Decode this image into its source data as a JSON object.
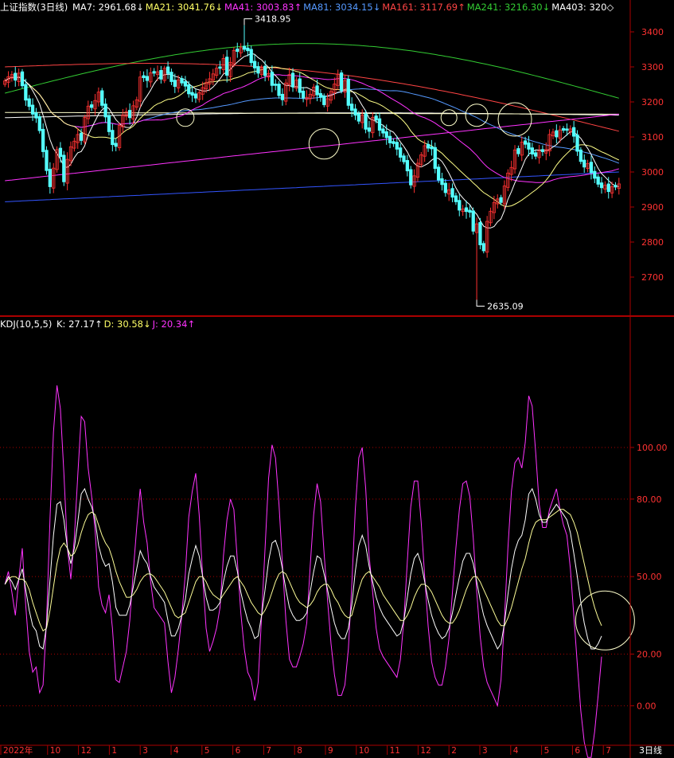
{
  "header": {
    "title": "上证指数(3日线)",
    "ma": [
      {
        "label": "MA7:",
        "value": "2961.68",
        "arrow": "↓",
        "color": "#ffffff"
      },
      {
        "label": "MA21:",
        "value": "3041.76",
        "arrow": "↓",
        "color": "#ffff66"
      },
      {
        "label": "MA41:",
        "value": "3003.83",
        "arrow": "↑",
        "color": "#ff33ff"
      },
      {
        "label": "MA81:",
        "value": "3034.15",
        "arrow": "↓",
        "color": "#5599ff"
      },
      {
        "label": "MA161:",
        "value": "3117.69",
        "arrow": "↑",
        "color": "#ff4444"
      },
      {
        "label": "MA241:",
        "value": "3216.30",
        "arrow": "↓",
        "color": "#33cc33"
      },
      {
        "label": "MA403:",
        "value": "320",
        "arrow": "◇",
        "color": "#ffffff"
      }
    ]
  },
  "kdj_header": {
    "title": "KDJ(10,5,5)",
    "items": [
      {
        "label": "K:",
        "value": "27.17",
        "arrow": "↑",
        "color": "#ffffff"
      },
      {
        "label": "D:",
        "value": "30.58",
        "arrow": "↓",
        "color": "#ffff66"
      },
      {
        "label": "J:",
        "value": "20.34",
        "arrow": "↑",
        "color": "#ff33ff"
      }
    ]
  },
  "colors": {
    "up": "#ff3232",
    "down": "#54ffff",
    "axis": "#aa0000",
    "tick": "#ff3232",
    "ma7": "#ffffff",
    "ma21": "#ffff88",
    "ma41": "#ff33ff",
    "ma81": "#5599ff",
    "ma161": "#ff4444",
    "ma241": "#33cc33",
    "ma403": "#ffffff"
  },
  "chart_data": [
    {
      "type": "candlestick",
      "title": "上证指数(3日线)",
      "ylim": [
        2600,
        3450
      ],
      "y_ticks": [
        "3400",
        "3300",
        "3200",
        "3100",
        "3000",
        "2900",
        "2800",
        "2700"
      ],
      "annotations": [
        {
          "label": "3418.95",
          "kind": "high",
          "value": 3418.95,
          "index": 69
        },
        {
          "label": "2635.09",
          "kind": "low",
          "value": 2635.09,
          "index": 136
        }
      ],
      "closes": [
        3260,
        3272,
        3278,
        3262,
        3282,
        3246,
        3205,
        3187,
        3165,
        3154,
        3118,
        3058,
        3004,
        2958,
        3011,
        3064,
        3044,
        2972,
        3036,
        3072,
        3088,
        3107,
        3090,
        3156,
        3188,
        3184,
        3204,
        3228,
        3190,
        3157,
        3115,
        3078,
        3073,
        3133,
        3163,
        3172,
        3155,
        3189,
        3206,
        3271,
        3269,
        3261,
        3283,
        3282,
        3286,
        3265,
        3296,
        3281,
        3258,
        3244,
        3263,
        3254,
        3245,
        3223,
        3219,
        3211,
        3226,
        3241,
        3255,
        3266,
        3280,
        3296,
        3296,
        3324,
        3276,
        3313,
        3347,
        3344,
        3355,
        3350,
        3346,
        3312,
        3297,
        3282,
        3298,
        3275,
        3281,
        3247,
        3247,
        3218,
        3206,
        3254,
        3278,
        3243,
        3262,
        3227,
        3211,
        3213,
        3222,
        3242,
        3220,
        3213,
        3192,
        3209,
        3230,
        3251,
        3279,
        3232,
        3261,
        3190,
        3176,
        3162,
        3145,
        3162,
        3122,
        3116,
        3156,
        3148,
        3119,
        3111,
        3098,
        3083,
        3081,
        3065,
        3042,
        3029,
        3003,
        2963,
        2989,
        3025,
        3049,
        3075,
        3068,
        3066,
        3010,
        2977,
        2964,
        2941,
        2949,
        2928,
        2915,
        2891,
        2894,
        2887,
        2885,
        2831,
        2852,
        2792,
        2775,
        2859,
        2888,
        2913,
        2923,
        2913,
        2960,
        2997,
        3013,
        3063,
        3052,
        3085,
        3079,
        3065,
        3051,
        3045,
        3060,
        3058,
        3064,
        3107,
        3114,
        3100,
        3120,
        3119,
        3119,
        3123,
        3102,
        3059,
        3030,
        3014,
        3024,
        2998,
        2982,
        2965,
        2955,
        2962,
        2944,
        2958,
        2957,
        2966
      ]
    },
    {
      "type": "line",
      "title": "KDJ(10,5,5)",
      "ylim": [
        -15,
        145
      ],
      "y_ticks": [
        "100.00",
        "80.00",
        "50.00",
        "20.00",
        "0.00"
      ],
      "x_labels": [
        "2022年",
        "10",
        "12",
        "1",
        "3",
        "4",
        "5",
        "6",
        "7",
        "8",
        "9",
        "10",
        "11",
        "12",
        "2",
        "3",
        "4",
        "5",
        "6",
        "7"
      ],
      "x_label_period": "3日线",
      "series": [
        {
          "name": "K",
          "values": [
            47,
            50,
            48,
            45,
            49,
            53,
            45,
            37,
            31,
            29,
            23,
            22,
            31,
            49,
            66,
            78,
            79,
            72,
            61,
            55,
            61,
            71,
            82,
            84,
            80,
            77,
            72,
            62,
            57,
            54,
            55,
            48,
            38,
            35,
            35,
            35,
            39,
            46,
            53,
            60,
            57,
            55,
            50,
            46,
            44,
            42,
            40,
            33,
            27,
            27,
            30,
            35,
            41,
            51,
            57,
            62,
            58,
            50,
            42,
            37,
            37,
            38,
            40,
            48,
            54,
            58,
            58,
            52,
            44,
            38,
            33,
            30,
            26,
            27,
            35,
            45,
            56,
            63,
            64,
            60,
            53,
            45,
            38,
            35,
            33,
            33,
            34,
            36,
            44,
            52,
            58,
            57,
            51,
            45,
            38,
            32,
            28,
            26,
            26,
            30,
            39,
            52,
            62,
            66,
            62,
            54,
            48,
            42,
            38,
            35,
            33,
            31,
            29,
            27,
            28,
            33,
            42,
            51,
            57,
            59,
            55,
            48,
            41,
            35,
            31,
            28,
            26,
            27,
            30,
            36,
            43,
            50,
            56,
            59,
            59,
            55,
            48,
            41,
            35,
            31,
            28,
            25,
            22,
            24,
            32,
            43,
            53,
            60,
            64,
            66,
            72,
            82,
            84,
            80,
            74,
            71,
            71,
            74,
            76,
            78,
            76,
            74,
            72,
            67,
            59,
            50,
            40,
            32,
            26,
            22,
            22,
            24,
            27
          ]
        },
        {
          "name": "D",
          "values": [
            47,
            49,
            50,
            50,
            49,
            49,
            48,
            45,
            40,
            36,
            32,
            29,
            30,
            37,
            46,
            55,
            61,
            63,
            61,
            58,
            59,
            62,
            67,
            71,
            74,
            75,
            74,
            70,
            66,
            63,
            61,
            57,
            52,
            48,
            45,
            42,
            42,
            43,
            45,
            48,
            50,
            51,
            51,
            50,
            48,
            46,
            44,
            41,
            38,
            35,
            34,
            35,
            36,
            40,
            44,
            48,
            50,
            50,
            48,
            45,
            43,
            42,
            41,
            43,
            45,
            47,
            49,
            50,
            48,
            46,
            43,
            40,
            38,
            36,
            35,
            37,
            40,
            44,
            48,
            51,
            52,
            51,
            48,
            45,
            42,
            40,
            39,
            38,
            39,
            41,
            44,
            46,
            47,
            47,
            45,
            42,
            40,
            37,
            35,
            34,
            35,
            40,
            45,
            49,
            51,
            52,
            50,
            48,
            46,
            43,
            41,
            39,
            37,
            35,
            33,
            33,
            35,
            38,
            42,
            45,
            47,
            47,
            46,
            44,
            41,
            38,
            35,
            33,
            32,
            32,
            34,
            37,
            41,
            45,
            48,
            50,
            50,
            48,
            45,
            42,
            39,
            36,
            33,
            31,
            31,
            34,
            38,
            43,
            48,
            53,
            57,
            63,
            68,
            71,
            72,
            72,
            72,
            73,
            74,
            75,
            76,
            76,
            75,
            74,
            71,
            67,
            61,
            55,
            49,
            43,
            38,
            34,
            31
          ]
        },
        {
          "name": "J",
          "values": [
            47,
            52,
            44,
            35,
            49,
            61,
            39,
            21,
            13,
            15,
            5,
            8,
            33,
            73,
            106,
            124,
            115,
            90,
            61,
            49,
            65,
            89,
            112,
            110,
            92,
            81,
            68,
            46,
            39,
            36,
            43,
            30,
            10,
            9,
            15,
            21,
            33,
            52,
            69,
            84,
            71,
            63,
            48,
            38,
            36,
            34,
            32,
            17,
            5,
            11,
            22,
            35,
            51,
            73,
            83,
            90,
            74,
            50,
            30,
            21,
            25,
            30,
            38,
            58,
            72,
            80,
            76,
            56,
            36,
            22,
            13,
            10,
            2,
            9,
            35,
            61,
            88,
            101,
            96,
            78,
            55,
            33,
            18,
            15,
            15,
            19,
            24,
            32,
            54,
            74,
            86,
            79,
            59,
            41,
            24,
            12,
            4,
            4,
            8,
            22,
            47,
            76,
            96,
            100,
            84,
            58,
            44,
            30,
            22,
            19,
            17,
            15,
            13,
            11,
            18,
            33,
            56,
            77,
            87,
            87,
            71,
            50,
            31,
            17,
            11,
            8,
            8,
            15,
            26,
            44,
            61,
            76,
            86,
            87,
            81,
            65,
            44,
            27,
            15,
            9,
            6,
            3,
            0,
            10,
            34,
            61,
            83,
            94,
            96,
            92,
            102,
            120,
            116,
            98,
            78,
            69,
            69,
            76,
            80,
            84,
            76,
            70,
            66,
            53,
            35,
            16,
            -2,
            -14,
            -20,
            -20,
            -10,
            4,
            19
          ]
        }
      ]
    }
  ]
}
